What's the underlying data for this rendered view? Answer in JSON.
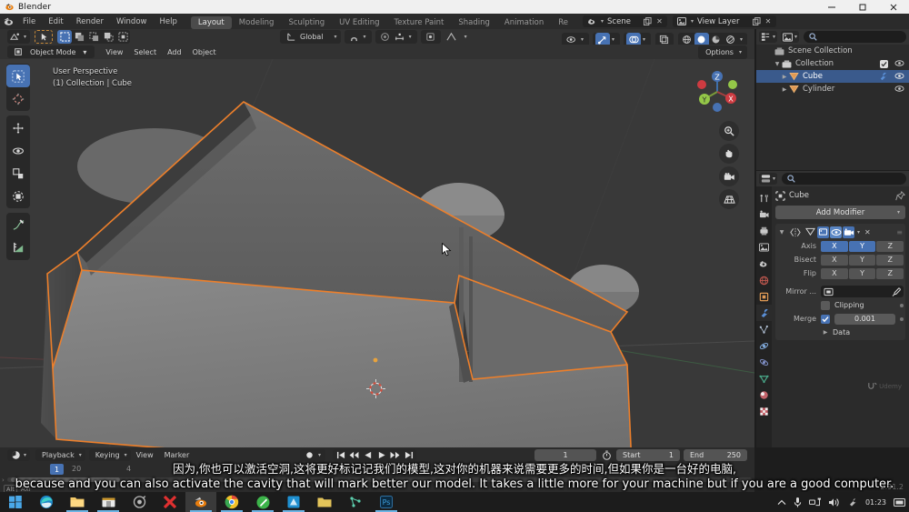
{
  "window": {
    "title": "Blender",
    "minimize": "—",
    "maximize": "❐",
    "close": "✕"
  },
  "topbar": {
    "menus": [
      "File",
      "Edit",
      "Render",
      "Window",
      "Help"
    ],
    "workspaces": [
      "Layout",
      "Modeling",
      "Sculpting",
      "UV Editing",
      "Texture Paint",
      "Shading",
      "Animation",
      "Re"
    ],
    "active_workspace": "Layout",
    "scene_name": "Scene",
    "viewlayer_name": "View Layer"
  },
  "viewport_header": {
    "mode": "Object Mode",
    "menus": [
      "View",
      "Select",
      "Add",
      "Object"
    ],
    "orientation": "Global",
    "options_label": "Options"
  },
  "viewport": {
    "perspective_line1": "User Perspective",
    "perspective_line2": "(1) Collection | Cube",
    "gizmo_axes": [
      "X",
      "Y",
      "Z"
    ],
    "gizmo_colors": {
      "x": "#cd3b41",
      "y": "#94c748",
      "z": "#4772b3"
    }
  },
  "tools": [
    {
      "name": "tweak-select",
      "active": true
    },
    {
      "name": "cursor",
      "active": false
    },
    {
      "name": "move",
      "active": false
    },
    {
      "name": "rotate",
      "active": false
    },
    {
      "name": "scale",
      "active": false
    },
    {
      "name": "transform",
      "active": false
    },
    {
      "name": "annotate",
      "active": false
    },
    {
      "name": "measure",
      "active": false
    }
  ],
  "outliner": {
    "rows": [
      {
        "label": "Scene Collection",
        "indent": 0,
        "selected": false,
        "has_arrow": false,
        "eye": true,
        "check": false
      },
      {
        "label": "Collection",
        "indent": 1,
        "selected": false,
        "has_arrow": true,
        "eye": true,
        "check": true
      },
      {
        "label": "Cube",
        "indent": 2,
        "selected": true,
        "has_arrow": true,
        "eye": true,
        "check": false
      },
      {
        "label": "Cylinder",
        "indent": 2,
        "selected": false,
        "has_arrow": true,
        "eye": true,
        "check": false
      }
    ]
  },
  "properties": {
    "object_name": "Cube",
    "add_modifier_label": "Add Modifier",
    "modifier": {
      "type": "Mirror",
      "rows": [
        {
          "label": "Axis",
          "buttons": [
            {
              "t": "X",
              "on": true
            },
            {
              "t": "Y",
              "on": true
            },
            {
              "t": "Z",
              "on": false
            }
          ]
        },
        {
          "label": "Bisect",
          "buttons": [
            {
              "t": "X",
              "on": false
            },
            {
              "t": "Y",
              "on": false
            },
            {
              "t": "Z",
              "on": false
            }
          ]
        },
        {
          "label": "Flip",
          "buttons": [
            {
              "t": "X",
              "on": false
            },
            {
              "t": "Y",
              "on": false
            },
            {
              "t": "Z",
              "on": false
            }
          ]
        }
      ],
      "mirror_object_label": "Mirror ...",
      "clipping_label": "Clipping",
      "clipping_on": false,
      "merge_label": "Merge",
      "merge_on": true,
      "merge_value": "0.001",
      "data_label": "Data"
    },
    "watermark": "Udemy"
  },
  "timeline": {
    "menus": [
      "Playback",
      "Keying",
      "View",
      "Marker"
    ],
    "current_frame": "1",
    "ruler_ticks": [
      "1",
      "20",
      "4"
    ],
    "frame_field": "1",
    "start_label": "Start",
    "start_value": "1",
    "end_label": "End",
    "end_value": "250"
  },
  "subtitles": {
    "chinese": "因为,你也可以激活空洞,这将更好标记记我们的模型,这对你的机器来说需要更多的时间,但如果你是一台好的电脑,",
    "english": "because and you can also activate the cavity that will mark better our model. It takes a little more for your machine but if you are a good computer."
  },
  "status": {
    "blender_version": "2.91.2",
    "clock": "01:23"
  },
  "taskbar": {
    "items": [
      {
        "name": "start-button",
        "glyph": "win"
      },
      {
        "name": "edge-icon",
        "glyph": "edge"
      },
      {
        "name": "file-explorer-icon",
        "glyph": "folder"
      },
      {
        "name": "store-icon",
        "glyph": "store"
      },
      {
        "name": "app-icon",
        "glyph": "app"
      },
      {
        "name": "xmind-icon",
        "glyph": "x"
      },
      {
        "name": "blender-icon",
        "glyph": "blender"
      },
      {
        "name": "chrome-icon",
        "glyph": "chrome"
      },
      {
        "name": "app-green-icon",
        "glyph": "green"
      },
      {
        "name": "app-blue-icon",
        "glyph": "blue"
      },
      {
        "name": "folder-yellow-icon",
        "glyph": "folderY"
      },
      {
        "name": "app-teal-icon",
        "glyph": "teal"
      },
      {
        "name": "photoshop-icon",
        "glyph": "ps"
      }
    ]
  }
}
